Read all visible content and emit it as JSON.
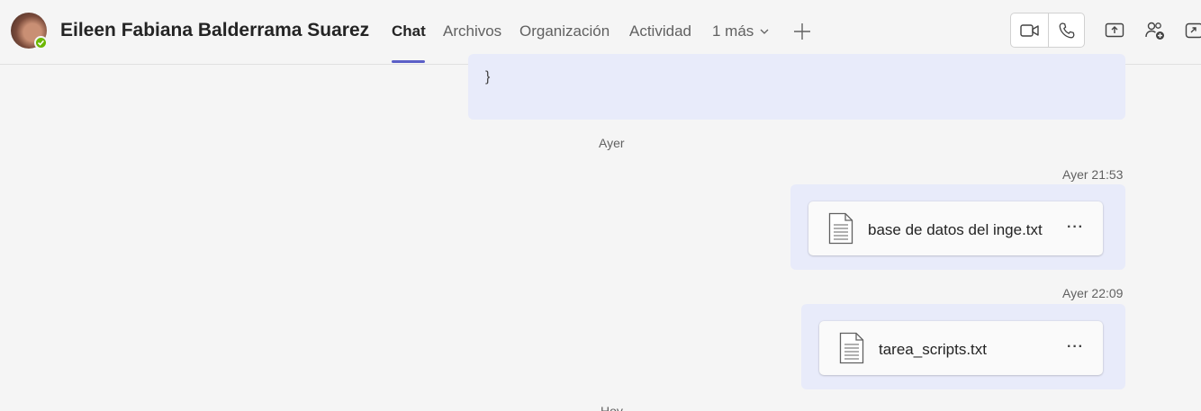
{
  "header": {
    "contact_name": "Eileen Fabiana Balderrama Suarez",
    "presence": "available",
    "presence_color": "#6bb700",
    "tabs": [
      {
        "label": "Chat",
        "active": true
      },
      {
        "label": "Archivos",
        "active": false
      },
      {
        "label": "Organización",
        "active": false
      },
      {
        "label": "Actividad",
        "active": false
      },
      {
        "label": "1 más",
        "active": false
      }
    ],
    "accent_color": "#5b5fc7",
    "icons": {
      "more_tabs": "chevron-down-icon",
      "add_tab": "plus-icon",
      "video_call": "video-camera-icon",
      "audio_call": "phone-icon",
      "share_screen": "share-screen-icon",
      "add_people": "add-people-icon",
      "pop_out": "pop-out-icon"
    }
  },
  "chat": {
    "prev_message_tail": "}",
    "day_divider_1": "Ayer",
    "messages": [
      {
        "timestamp": "Ayer 21:53",
        "file_name": "base de datos del inge.txt",
        "file_icon": "text-file-icon",
        "more_label": "···"
      },
      {
        "timestamp": "Ayer 22:09",
        "file_name": "tarea_scripts.txt",
        "file_icon": "text-file-icon",
        "more_label": "···"
      }
    ],
    "day_divider_2": "Hoy"
  }
}
